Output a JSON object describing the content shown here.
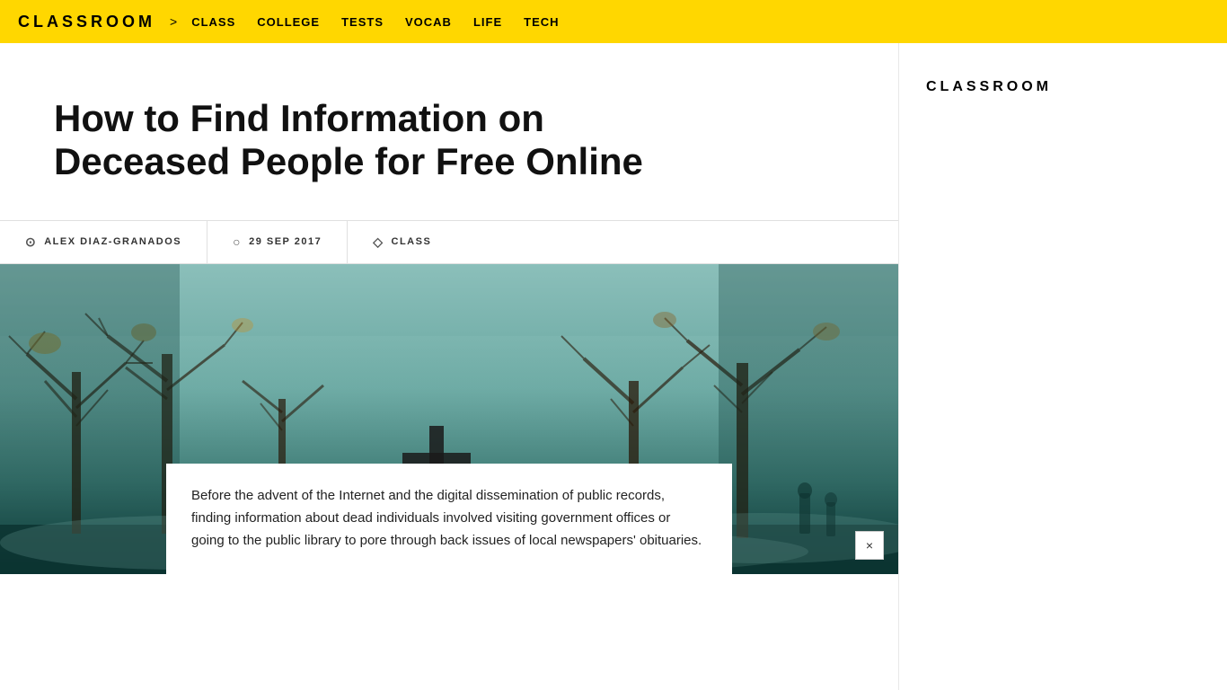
{
  "header": {
    "logo": "CLASSROOM",
    "arrow": ">",
    "nav": [
      {
        "label": "CLASS",
        "id": "nav-class"
      },
      {
        "label": "COLLEGE",
        "id": "nav-college"
      },
      {
        "label": "TESTS",
        "id": "nav-tests"
      },
      {
        "label": "VOCAB",
        "id": "nav-vocab"
      },
      {
        "label": "LIFE",
        "id": "nav-life"
      },
      {
        "label": "TECH",
        "id": "nav-tech"
      }
    ]
  },
  "article": {
    "title": "How to Find Information on Deceased People for Free Online",
    "meta": {
      "author": "ALEX DIAZ-GRANADOS",
      "date": "29 SEP 2017",
      "category": "CLASS"
    },
    "body": "Before the advent of the Internet and the digital dissemination of public records, finding information about dead individuals involved visiting government offices or going to the public library to pore through back issues of local newspapers' obituaries."
  },
  "sidebar": {
    "logo": "CLASSROOM"
  },
  "close_button": "×"
}
